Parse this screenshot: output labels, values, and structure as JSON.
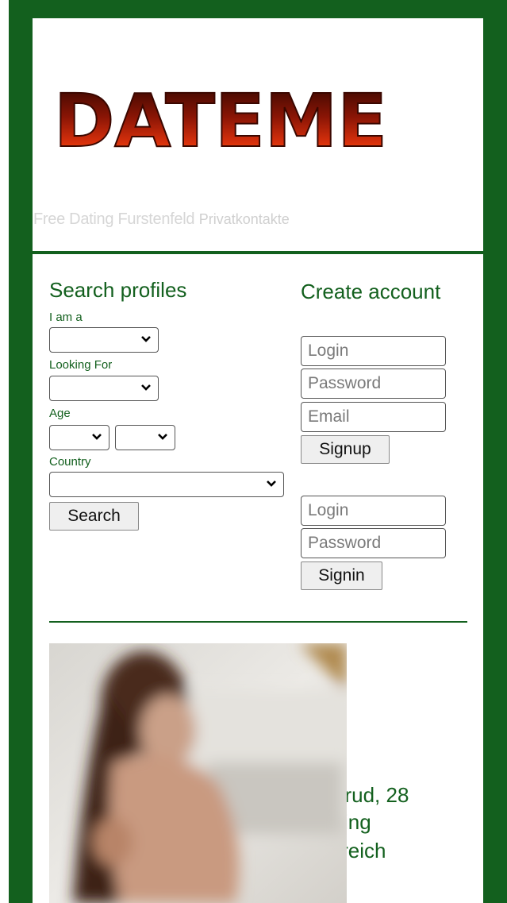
{
  "header": {
    "logo_text": "DATEME",
    "tagline_main": "Free Dating Furstenfeld",
    "tagline_sub": "Privatkontakte"
  },
  "search": {
    "title": "Search profiles",
    "iam_label": "I am a",
    "looking_label": "Looking For",
    "age_label": "Age",
    "country_label": "Country",
    "button_label": "Search"
  },
  "signup": {
    "title": "Create account",
    "login_placeholder": "Login",
    "password_placeholder": "Password",
    "email_placeholder": "Email",
    "button_label": "Signup"
  },
  "signin": {
    "login_placeholder": "Login",
    "password_placeholder": "Password",
    "button_label": "Signin"
  },
  "profile": {
    "line1": "eltrud, 28",
    "line2": "ssing",
    "line3": "erreich"
  },
  "colors": {
    "brand_green": "#13601e",
    "logo_red": "#c0200c"
  }
}
